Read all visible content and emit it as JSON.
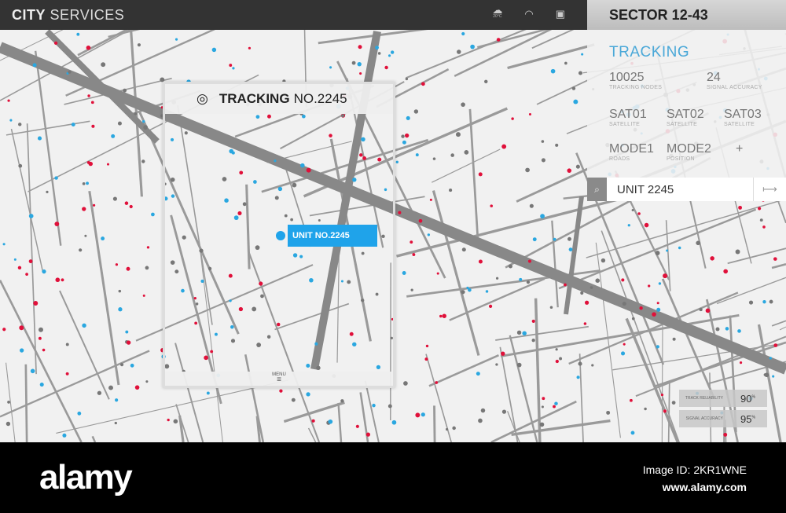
{
  "header": {
    "title_bold": "CITY",
    "title_rest": "SERVICES",
    "icons": [
      "weather-icon",
      "wifi-icon",
      "chat-icon"
    ],
    "weather_temp": "20°C"
  },
  "sidebar": {
    "sector": "SECTOR 12-43",
    "tracking_label": "TRACKING",
    "stats": [
      {
        "value": "10025",
        "label": "TRACKING NODES"
      },
      {
        "value": "24",
        "label": "SIGNAL ACCURACY"
      }
    ],
    "satellites": [
      {
        "value": "SAT01",
        "label": "SATELLITE"
      },
      {
        "value": "SAT02",
        "label": "SATELLITE"
      },
      {
        "value": "SAT03",
        "label": "SATELLITE"
      }
    ],
    "modes": [
      {
        "value": "MODE1",
        "label": "ROADS"
      },
      {
        "value": "MODE2",
        "label": "POSITION"
      },
      {
        "value": "+",
        "label": ""
      }
    ],
    "search_value": "UNIT 2245",
    "search_go": "⟼"
  },
  "tracking_window": {
    "title_bold": "TRACKING",
    "title_rest": "NO.2245",
    "unit_label": "UNIT NO.2245",
    "menu_label": "MENU"
  },
  "metrics": [
    {
      "label": "TRACK RELIABILITY",
      "value": "90",
      "unit": "%"
    },
    {
      "label": "SIGNAL ACCURACY",
      "value": "95",
      "unit": "%"
    }
  ],
  "colors": {
    "accent": "#1fa3ea",
    "red": "#e0103a",
    "blue": "#2aa7e0",
    "road": "#8c8c8c"
  },
  "footer": {
    "logo": "alamy",
    "image_id": "Image ID: 2KR1WNE",
    "url": "www.alamy.com"
  }
}
